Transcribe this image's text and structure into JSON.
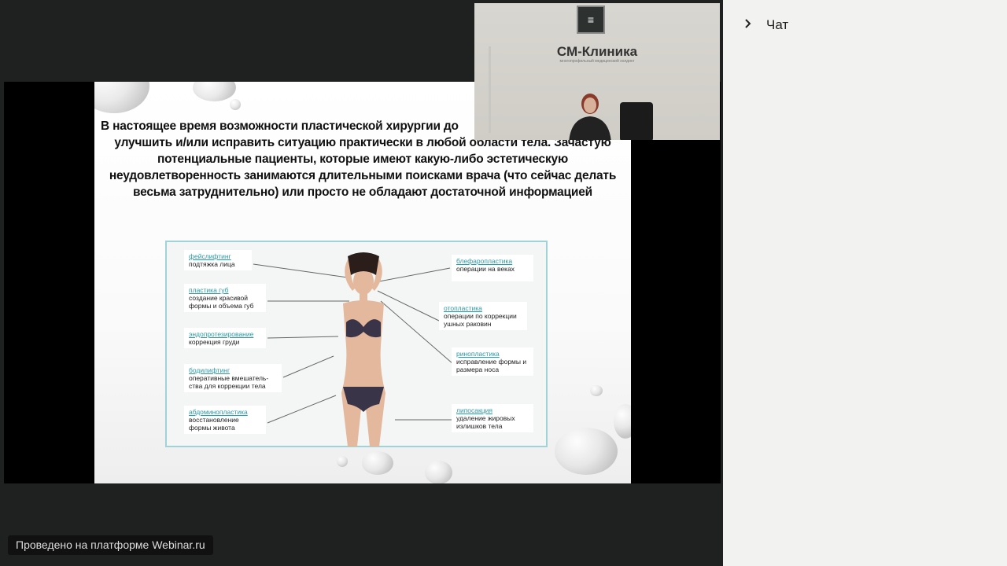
{
  "slide": {
    "title_lines": [
      "В настоящее время возможности пластической хирургии до",
      "улучшить и/или исправить ситуацию практически в любой области тела.  Зачастую",
      "потенциальные пациенты, которые имеют какую-либо эстетическую",
      "неудовлетворенность занимаются длительными поисками врача (что сейчас делать",
      "весьма затруднительно)  или просто не обладают достаточной информацией"
    ],
    "left_labels": [
      {
        "title": "фейслифтинг",
        "desc": "подтяжка лица"
      },
      {
        "title": "пластика губ",
        "desc": "создание красивой формы и объема губ"
      },
      {
        "title": "эндопротезирование",
        "desc": "коррекция груди"
      },
      {
        "title": "бодилифтинг",
        "desc": "оперативные вмешатель-ства для коррекции тела"
      },
      {
        "title": "абдоминопластика",
        "desc": "восстановление формы живота"
      }
    ],
    "right_labels": [
      {
        "title": "блефаропластика",
        "desc": "операции на веках"
      },
      {
        "title": "отопластика",
        "desc": "операции по коррекции ушных раковин"
      },
      {
        "title": "ринопластика",
        "desc": "исправление формы и размера носа"
      },
      {
        "title": "липосакция",
        "desc": "удаление жировых излишков тела"
      }
    ]
  },
  "webcam": {
    "brand": "СМ-Клиника",
    "brand_sub": "многопрофильный медицинский холдинг"
  },
  "chat": {
    "label": "Чат",
    "icon": "chevron-right-icon"
  },
  "footer": {
    "text": "Проведено на платформе Webinar.ru"
  }
}
